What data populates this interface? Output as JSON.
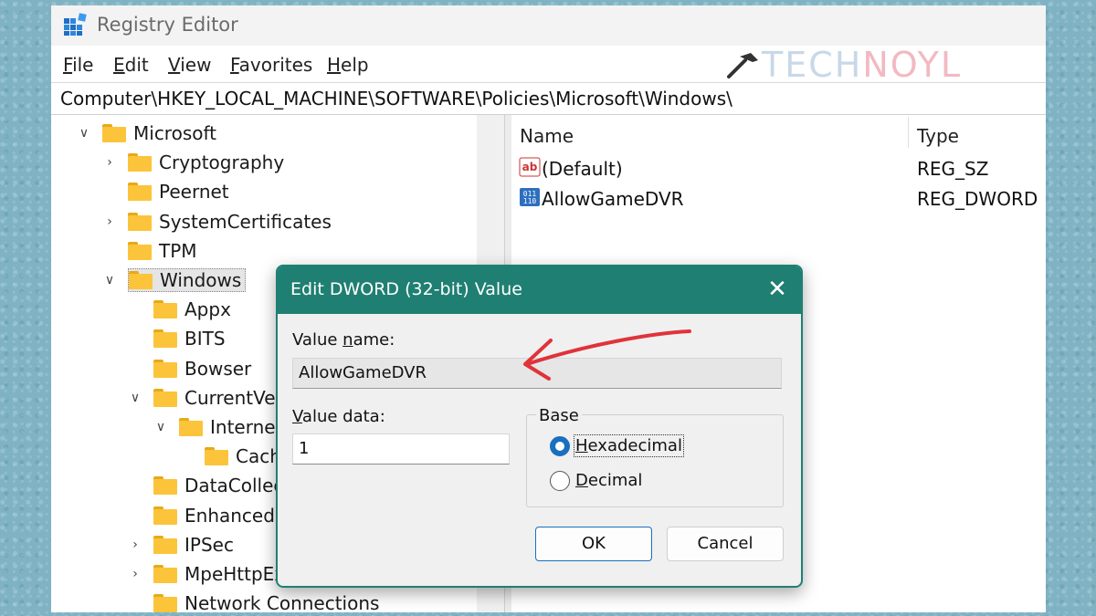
{
  "window": {
    "title": "Registry Editor",
    "watermark_a": "TECH",
    "watermark_b": "NOYL"
  },
  "menu": {
    "file": {
      "mnemonic": "F",
      "rest": "ile"
    },
    "edit": {
      "mnemonic": "E",
      "rest": "dit"
    },
    "view": {
      "mnemonic": "V",
      "rest": "iew"
    },
    "favorites": {
      "mnemonic": "F",
      "pre": "",
      "rest": "avorites",
      "label": "Favorites"
    },
    "help": {
      "mnemonic": "H",
      "rest": "elp"
    }
  },
  "address": "Computer\\HKEY_LOCAL_MACHINE\\SOFTWARE\\Policies\\Microsoft\\Windows\\",
  "tree": [
    {
      "label": "Microsoft",
      "chevron": "open"
    },
    {
      "label": "Cryptography",
      "chevron": "closed"
    },
    {
      "label": "Peernet",
      "chevron": "none"
    },
    {
      "label": "SystemCertificates",
      "chevron": "closed"
    },
    {
      "label": "TPM",
      "chevron": "none"
    },
    {
      "label": "Windows",
      "chevron": "open",
      "selected": true
    },
    {
      "label": "Appx",
      "chevron": "none"
    },
    {
      "label": "BITS",
      "chevron": "none"
    },
    {
      "label": "Bowser",
      "chevron": "none"
    },
    {
      "label": "CurrentVers",
      "chevron": "open"
    },
    {
      "label": "Internet",
      "chevron": "open"
    },
    {
      "label": "Cache",
      "chevron": "none"
    },
    {
      "label": "DataCollect",
      "chevron": "none"
    },
    {
      "label": "EnhancedSt",
      "chevron": "none"
    },
    {
      "label": "IPSec",
      "chevron": "closed"
    },
    {
      "label": "MpeHttpEx",
      "chevron": "closed"
    },
    {
      "label": "Network Connections",
      "chevron": "none"
    }
  ],
  "list": {
    "headers": {
      "name": "Name",
      "type": "Type"
    },
    "rows": [
      {
        "name": "(Default)",
        "type": "REG_SZ",
        "icon": "string-value-icon"
      },
      {
        "name": "AllowGameDVR",
        "type": "REG_DWORD",
        "icon": "dword-value-icon"
      }
    ]
  },
  "dialog": {
    "title": "Edit DWORD (32-bit) Value",
    "value_name_label": {
      "pre": "Value ",
      "mnemonic": "n",
      "rest": "ame:"
    },
    "value_name": "AllowGameDVR",
    "value_data_label": {
      "mnemonic": "V",
      "rest": "alue data:"
    },
    "value_data": "1",
    "base_label": "Base",
    "base_options": [
      {
        "mnemonic": "H",
        "rest": "exadecimal",
        "selected": true
      },
      {
        "mnemonic": "D",
        "rest": "ecimal",
        "selected": false
      }
    ],
    "ok_label": "OK",
    "cancel_label": "Cancel"
  },
  "colors": {
    "dialog_accent": "#1f7f72",
    "arrow": "#e0333a",
    "folder": "#fbc43a"
  }
}
